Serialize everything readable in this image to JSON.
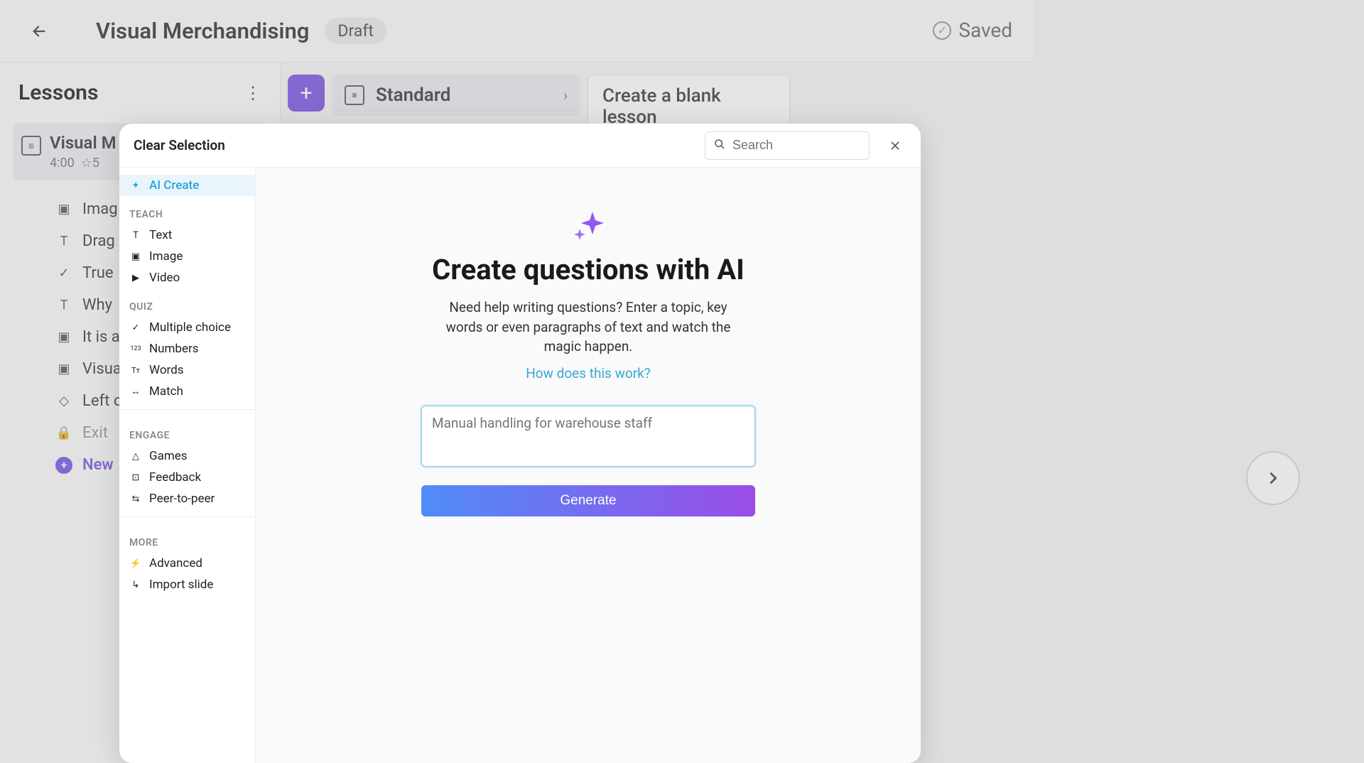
{
  "header": {
    "title": "Visual Merchandising",
    "status_badge": "Draft",
    "saved_label": "Saved"
  },
  "left_panel": {
    "heading": "Lessons",
    "lesson_card": {
      "title": "Visual M",
      "duration": "4:00",
      "rating_icon": "☆",
      "rating": "5"
    },
    "slides": [
      {
        "icon": "image",
        "label": "Imag"
      },
      {
        "icon": "text",
        "label": "Drag"
      },
      {
        "icon": "check",
        "label": "True"
      },
      {
        "icon": "text",
        "label": "Why"
      },
      {
        "icon": "image",
        "label": "It is a"
      },
      {
        "icon": "image",
        "label": "Visua"
      },
      {
        "icon": "shapes",
        "label": "Left o"
      },
      {
        "icon": "lock",
        "label": "Exit"
      }
    ],
    "new_slide_label": "New"
  },
  "bg_buttons": {
    "standard": "Standard",
    "blank": "Create a blank lesson"
  },
  "modal": {
    "clear_label": "Clear Selection",
    "search_placeholder": "Search",
    "side": {
      "ai_create": "AI Create",
      "teach_header": "TEACH",
      "teach_items": [
        {
          "icon": "T",
          "label": "Text"
        },
        {
          "icon": "▣",
          "label": "Image"
        },
        {
          "icon": "▶",
          "label": "Video"
        }
      ],
      "quiz_header": "QUIZ",
      "quiz_items": [
        {
          "icon": "✓",
          "label": "Multiple choice"
        },
        {
          "icon": "123",
          "label": "Numbers"
        },
        {
          "icon": "Tт",
          "label": "Words"
        },
        {
          "icon": "↔",
          "label": "Match"
        }
      ],
      "engage_header": "ENGAGE",
      "engage_items": [
        {
          "icon": "△",
          "label": "Games"
        },
        {
          "icon": "⊡",
          "label": "Feedback"
        },
        {
          "icon": "⇆",
          "label": "Peer-to-peer"
        }
      ],
      "more_header": "MORE",
      "more_items": [
        {
          "icon": "⚡",
          "label": "Advanced"
        },
        {
          "icon": "↳",
          "label": "Import slide"
        }
      ]
    },
    "main": {
      "title": "Create questions with AI",
      "subtitle": "Need help writing questions? Enter a topic, key words or even paragraphs of text and watch the magic happen.",
      "link": "How does this work?",
      "placeholder": "Manual handling for warehouse staff",
      "generate_label": "Generate"
    }
  }
}
